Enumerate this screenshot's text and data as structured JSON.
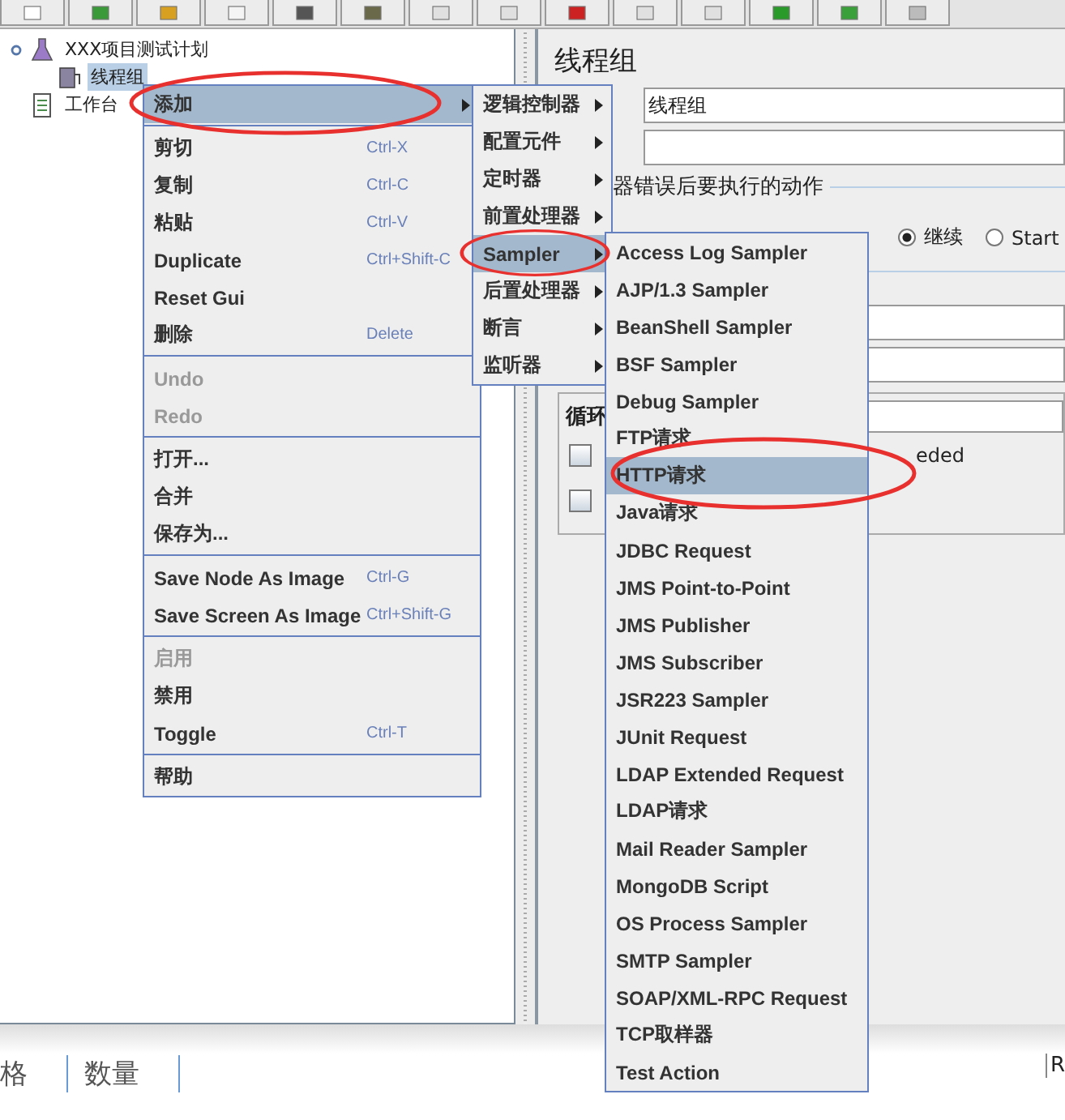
{
  "tree": {
    "items": [
      {
        "label": "XXX项目测试计划",
        "expanded": true,
        "selected": false,
        "children": [
          {
            "label": "线程组",
            "selected": true
          }
        ]
      },
      {
        "label": "工作台",
        "selected": false
      }
    ]
  },
  "panel": {
    "title": "线程组",
    "name_value": "线程组",
    "section_label": "器错误后要执行的动作",
    "radio_options": [
      {
        "label": "继续",
        "selected": true
      },
      {
        "label": "Start",
        "selected": false
      }
    ],
    "loop_label": "循环",
    "checkboxes": [
      {
        "checked": false
      },
      {
        "checked": false
      }
    ],
    "fragment": "eded"
  },
  "context_menu": {
    "items": [
      {
        "kind": "item",
        "label": "添加",
        "has_submenu": true,
        "disabled": false,
        "selected": true,
        "circled": true
      },
      {
        "kind": "separator"
      },
      {
        "kind": "item",
        "label": "剪切",
        "shortcut": "Ctrl-X",
        "has_submenu": false,
        "disabled": false,
        "selected": false,
        "circled": false
      },
      {
        "kind": "item",
        "label": "复制",
        "shortcut": "Ctrl-C",
        "has_submenu": false,
        "disabled": false,
        "selected": false,
        "circled": false
      },
      {
        "kind": "item",
        "label": "粘贴",
        "shortcut": "Ctrl-V",
        "has_submenu": false,
        "disabled": false,
        "selected": false,
        "circled": false
      },
      {
        "kind": "item",
        "label": "Duplicate",
        "shortcut": "Ctrl+Shift-C",
        "has_submenu": false,
        "disabled": false,
        "selected": false,
        "circled": false
      },
      {
        "kind": "item",
        "label": "Reset Gui",
        "has_submenu": false,
        "disabled": false,
        "selected": false,
        "circled": false
      },
      {
        "kind": "item",
        "label": "删除",
        "shortcut": "Delete",
        "has_submenu": false,
        "disabled": false,
        "selected": false,
        "circled": false
      },
      {
        "kind": "separator"
      },
      {
        "kind": "item",
        "label": "Undo",
        "has_submenu": false,
        "disabled": true,
        "selected": false,
        "circled": false
      },
      {
        "kind": "item",
        "label": "Redo",
        "has_submenu": false,
        "disabled": true,
        "selected": false,
        "circled": false
      },
      {
        "kind": "separator"
      },
      {
        "kind": "item",
        "label": "打开...",
        "has_submenu": false,
        "disabled": false,
        "selected": false,
        "circled": false
      },
      {
        "kind": "item",
        "label": "合并",
        "has_submenu": false,
        "disabled": false,
        "selected": false,
        "circled": false
      },
      {
        "kind": "item",
        "label": "保存为...",
        "has_submenu": false,
        "disabled": false,
        "selected": false,
        "circled": false
      },
      {
        "kind": "separator"
      },
      {
        "kind": "item",
        "label": "Save Node As Image",
        "shortcut": "Ctrl-G",
        "has_submenu": false,
        "disabled": false,
        "selected": false,
        "circled": false
      },
      {
        "kind": "item",
        "label": "Save Screen As Image",
        "shortcut": "Ctrl+Shift-G",
        "has_submenu": false,
        "disabled": false,
        "selected": false,
        "circled": false
      },
      {
        "kind": "separator"
      },
      {
        "kind": "item",
        "label": "启用",
        "has_submenu": false,
        "disabled": true,
        "selected": false,
        "circled": false
      },
      {
        "kind": "item",
        "label": "禁用",
        "has_submenu": false,
        "disabled": false,
        "selected": false,
        "circled": false
      },
      {
        "kind": "item",
        "label": "Toggle",
        "shortcut": "Ctrl-T",
        "has_submenu": false,
        "disabled": false,
        "selected": false,
        "circled": false
      },
      {
        "kind": "separator"
      },
      {
        "kind": "item",
        "label": "帮助",
        "has_submenu": false,
        "disabled": false,
        "selected": false,
        "circled": false
      }
    ]
  },
  "add_menu": {
    "items": [
      {
        "label": "逻辑控制器",
        "selected": false,
        "circled": false
      },
      {
        "label": "配置元件",
        "selected": false,
        "circled": false
      },
      {
        "label": "定时器",
        "selected": false,
        "circled": false
      },
      {
        "label": "前置处理器",
        "selected": false,
        "circled": false
      },
      {
        "label": "Sampler",
        "selected": true,
        "circled": true
      },
      {
        "label": "后置处理器",
        "selected": false,
        "circled": false
      },
      {
        "label": "断言",
        "selected": false,
        "circled": false
      },
      {
        "label": "监听器",
        "selected": false,
        "circled": false
      }
    ]
  },
  "sampler_menu": {
    "items": [
      {
        "label": "Access Log Sampler",
        "selected": false,
        "circled": false
      },
      {
        "label": "AJP/1.3 Sampler",
        "selected": false,
        "circled": false
      },
      {
        "label": "BeanShell Sampler",
        "selected": false,
        "circled": false
      },
      {
        "label": "BSF Sampler",
        "selected": false,
        "circled": false
      },
      {
        "label": "Debug Sampler",
        "selected": false,
        "circled": false
      },
      {
        "label": "FTP请求",
        "selected": false,
        "circled": false
      },
      {
        "label": "HTTP请求",
        "selected": true,
        "circled": true
      },
      {
        "label": "Java请求",
        "selected": false,
        "circled": false
      },
      {
        "label": "JDBC Request",
        "selected": false,
        "circled": false
      },
      {
        "label": "JMS Point-to-Point",
        "selected": false,
        "circled": false
      },
      {
        "label": "JMS Publisher",
        "selected": false,
        "circled": false
      },
      {
        "label": "JMS Subscriber",
        "selected": false,
        "circled": false
      },
      {
        "label": "JSR223 Sampler",
        "selected": false,
        "circled": false
      },
      {
        "label": "JUnit Request",
        "selected": false,
        "circled": false
      },
      {
        "label": "LDAP Extended Request",
        "selected": false,
        "circled": false
      },
      {
        "label": "LDAP请求",
        "selected": false,
        "circled": false
      },
      {
        "label": "Mail Reader Sampler",
        "selected": false,
        "circled": false
      },
      {
        "label": "MongoDB Script",
        "selected": false,
        "circled": false
      },
      {
        "label": "OS Process Sampler",
        "selected": false,
        "circled": false
      },
      {
        "label": "SMTP Sampler",
        "selected": false,
        "circled": false
      },
      {
        "label": "SOAP/XML-RPC Request",
        "selected": false,
        "circled": false
      },
      {
        "label": "TCP取样器",
        "selected": false,
        "circled": false
      },
      {
        "label": "Test Action",
        "selected": false,
        "circled": false
      }
    ]
  },
  "background_document": {
    "headers": [
      "格",
      "数量"
    ],
    "side_text": "R"
  }
}
